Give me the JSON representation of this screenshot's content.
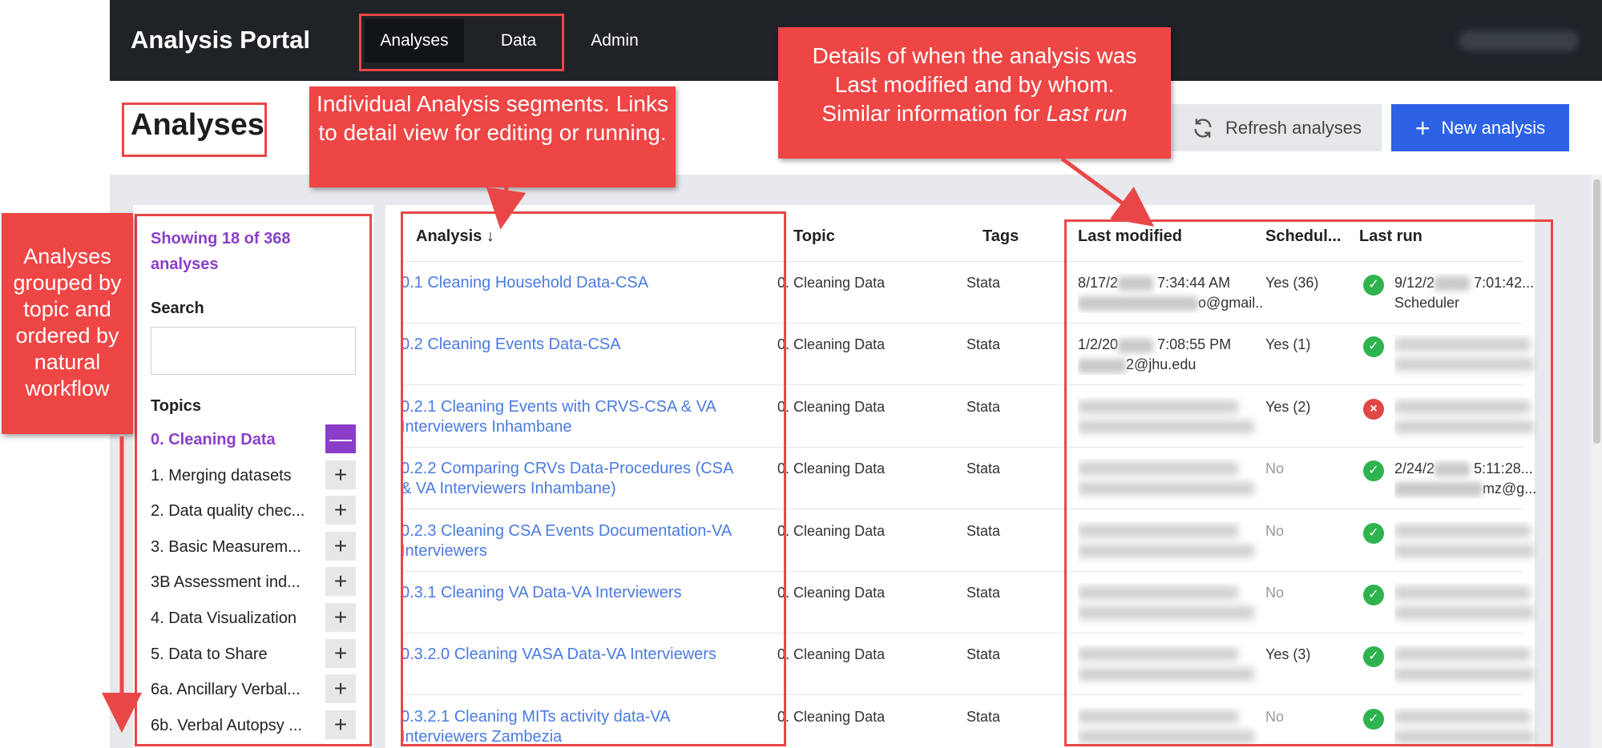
{
  "app": {
    "title": "Analysis Portal",
    "nav": [
      "Analyses",
      "Data",
      "Admin"
    ],
    "active_nav": "Analyses"
  },
  "page": {
    "title": "Analyses",
    "refresh_label": "Refresh analyses",
    "new_label": "New analysis"
  },
  "sidebar": {
    "showing": "Showing 18 of 368 analyses",
    "search_label": "Search",
    "search_value": "",
    "topics_label": "Topics",
    "topics": [
      {
        "label": "0. Cleaning Data",
        "active": true
      },
      {
        "label": "1. Merging datasets",
        "active": false
      },
      {
        "label": "2. Data quality chec...",
        "active": false
      },
      {
        "label": "3. Basic Measurem...",
        "active": false
      },
      {
        "label": "3B Assessment ind...",
        "active": false
      },
      {
        "label": "4. Data Visualization",
        "active": false
      },
      {
        "label": "5. Data to Share",
        "active": false
      },
      {
        "label": "6a. Ancillary Verbal...",
        "active": false
      },
      {
        "label": "6b. Verbal Autopsy ...",
        "active": false
      }
    ]
  },
  "table": {
    "headers": {
      "analysis": "Analysis ↓",
      "topic": "Topic",
      "tags": "Tags",
      "last_modified": "Last modified",
      "scheduled": "Schedul...",
      "last_run": "Last run"
    },
    "rows": [
      {
        "name": [
          "0.1 Cleaning Household Data-CSA"
        ],
        "topic": "0. Cleaning Data",
        "tags": "Stata",
        "mod": [
          "8/17/2",
          "7:34:44 AM",
          "o@gmail...."
        ],
        "scheduled": "Yes (36)",
        "status": "ok",
        "run": [
          "9/12/2",
          "7:01:42...",
          "Scheduler"
        ]
      },
      {
        "name": [
          "0.2 Cleaning Events Data-CSA"
        ],
        "topic": "0. Cleaning Data",
        "tags": "Stata",
        "mod": [
          "1/2/20",
          "7:08:55 PM",
          "2@jhu.edu"
        ],
        "scheduled": "Yes (1)",
        "status": "ok",
        "run": []
      },
      {
        "name": [
          "0.2.1 Cleaning Events with CRVS-CSA & VA",
          "Interviewers Inhambane"
        ],
        "topic": "0. Cleaning Data",
        "tags": "Stata",
        "mod": [],
        "scheduled": "Yes (2)",
        "status": "fail",
        "run": []
      },
      {
        "name": [
          "0.2.2 Comparing CRVs Data-Procedures (CSA",
          "& VA Interviewers Inhambane)"
        ],
        "topic": "0. Cleaning Data",
        "tags": "Stata",
        "mod": [],
        "scheduled": "No",
        "status": "ok",
        "run": [
          "2/24/2",
          "5:11:28...",
          "mz@g..."
        ]
      },
      {
        "name": [
          "0.2.3 Cleaning CSA Events Documentation-VA",
          "Interviewers"
        ],
        "topic": "0. Cleaning Data",
        "tags": "Stata",
        "mod": [],
        "scheduled": "No",
        "status": "ok",
        "run": []
      },
      {
        "name": [
          "0.3.1 Cleaning VA Data-VA Interviewers"
        ],
        "topic": "0. Cleaning Data",
        "tags": "Stata",
        "mod": [],
        "scheduled": "No",
        "status": "ok",
        "run": []
      },
      {
        "name": [
          "0.3.2.0 Cleaning VASA Data-VA Interviewers"
        ],
        "topic": "0. Cleaning Data",
        "tags": "Stata",
        "mod": [],
        "scheduled": "Yes (3)",
        "status": "ok",
        "run": []
      },
      {
        "name": [
          "0.3.2.1 Cleaning MITs activity data-VA",
          "Interviewers Zambezia"
        ],
        "topic": "0. Cleaning Data",
        "tags": "Stata",
        "mod": [],
        "scheduled": "No",
        "status": "ok",
        "run": []
      }
    ]
  },
  "annotations": {
    "segments": "Individual Analysis segments. Links to detail view for editing or running.",
    "details_line1": "Details of when the analysis was",
    "details_line2": "Last modified and by whom.",
    "details_line3": "Similar information for",
    "details_em": "Last run",
    "grouped": "Analyses grouped by topic and ordered by natural workflow"
  },
  "colors": {
    "nav_bg": "#1f2328",
    "accent_purple": "#8a3ec8",
    "primary_blue": "#2e62e6",
    "link_blue": "#4a7be0",
    "annotation_red": "#ee4545",
    "success_green": "#2fb34e",
    "error_red": "#e04848"
  }
}
